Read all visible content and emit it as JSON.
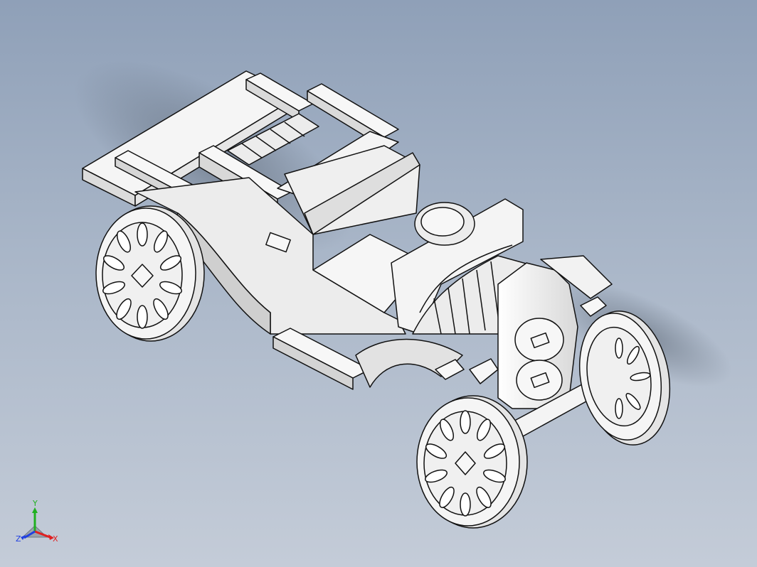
{
  "viewport": {
    "background_top": "#8fa0b8",
    "background_bottom": "#c4ccd8",
    "model_face_color": "#f2f2f2",
    "edge_color": "#111111"
  },
  "triad": {
    "x_label": "X",
    "y_label": "Y",
    "z_label": "Z",
    "x_color": "#e02020",
    "y_color": "#20b020",
    "z_color": "#2040e0"
  }
}
